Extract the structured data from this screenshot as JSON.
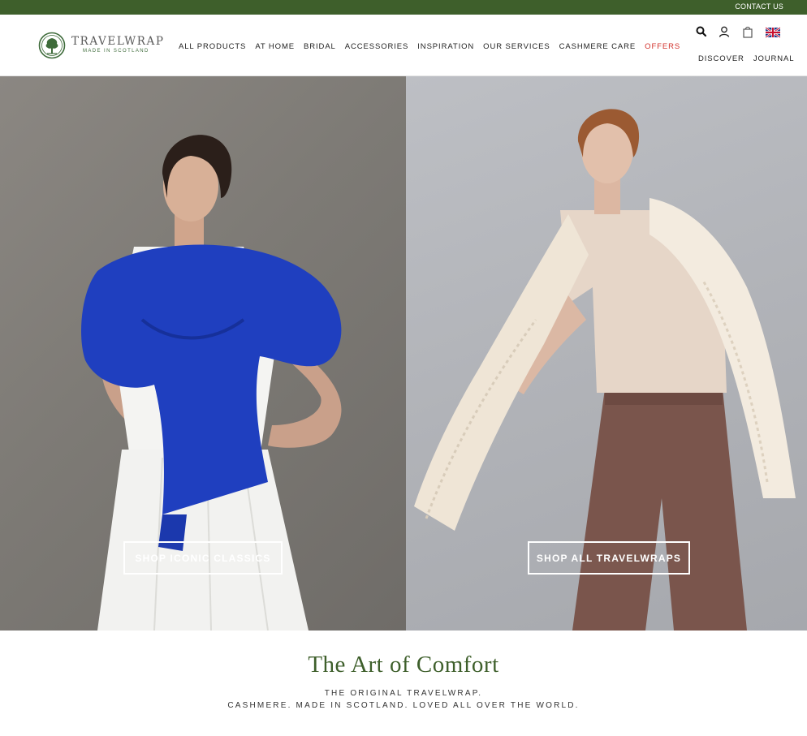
{
  "topbar": {
    "contact_label": "CONTACT US",
    "color": "#3e5f2b"
  },
  "brand": {
    "name": "TRAVELWRAP",
    "tagline": "MADE IN SCOTLAND"
  },
  "nav": {
    "items": [
      "ALL PRODUCTS",
      "AT HOME",
      "BRIDAL",
      "ACCESSORIES",
      "INSPIRATION",
      "OUR SERVICES",
      "CASHMERE CARE",
      "OFFERS"
    ],
    "offers_color": "#d2312b"
  },
  "utility": {
    "icons": [
      "search-icon",
      "account-icon",
      "bag-icon",
      "uk-flag-icon"
    ],
    "links": [
      "DISCOVER",
      "JOURNAL"
    ]
  },
  "hero": {
    "left_button": "SHOP ICONIC CLASSICS",
    "right_button": "SHOP ALL TRAVELWRAPS"
  },
  "intro": {
    "title": "The Art of Comfort",
    "line1": "THE ORIGINAL TRAVELWRAP.",
    "line2": "CASHMERE. MADE IN SCOTLAND. LOVED ALL OVER THE WORLD."
  }
}
